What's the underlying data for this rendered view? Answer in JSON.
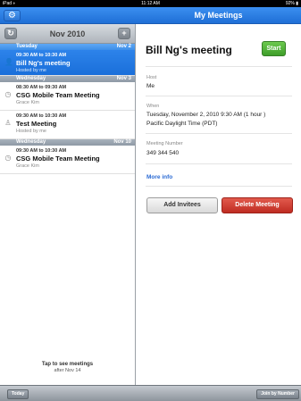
{
  "status": {
    "carrier": "iPad ",
    "wifi": "◗",
    "time": "11:12 AM",
    "battery": "92% ▮"
  },
  "nav": {
    "title": "My Meetings"
  },
  "sidebar": {
    "month": "Nov 2010",
    "days": [
      {
        "name": "Tuesday",
        "date": "Nov 2"
      },
      {
        "name": "Wednesday",
        "date": "Nov 3"
      },
      {
        "name": "Wednesday",
        "date": "Nov 10"
      }
    ],
    "meetings": [
      {
        "time": "09:30 AM to 10:30 AM",
        "name": "Bill Ng's meeting",
        "host": "Hosted by me"
      },
      {
        "time": "08:30 AM to 09:30 AM",
        "name": "CSG Mobile Team Meeting",
        "host": "Grace Kim"
      },
      {
        "time": "09:30 AM to 10:30 AM",
        "name": "Test Meeting",
        "host": "Hosted by me"
      },
      {
        "time": "09:30 AM to 10:30 AM",
        "name": "CSG Mobile Team Meeting",
        "host": "Grace Kim"
      }
    ],
    "tap_note": {
      "line1": "Tap to see meetings",
      "line2": "after Nov 14"
    }
  },
  "detail": {
    "title": "Bill Ng's meeting",
    "start_label": "Start",
    "host_label": "Host",
    "host_value": "Me",
    "when_label": "When",
    "when_line1": "Tuesday, November 2, 2010 9:30 AM (1 hour )",
    "when_line2": "Pacific Daylight Time (PDT)",
    "number_label": "Meeting Number",
    "number_value": "349 344 540",
    "more_info": "More info",
    "add_invitees": "Add Invitees",
    "delete_meeting": "Delete Meeting"
  },
  "toolbar": {
    "today": "Today",
    "join": "Join by Number"
  },
  "colors": {
    "accent": "#1f6fd6",
    "start": "#3e9e2a",
    "delete": "#bf2c22",
    "link": "#2a6ad4"
  }
}
